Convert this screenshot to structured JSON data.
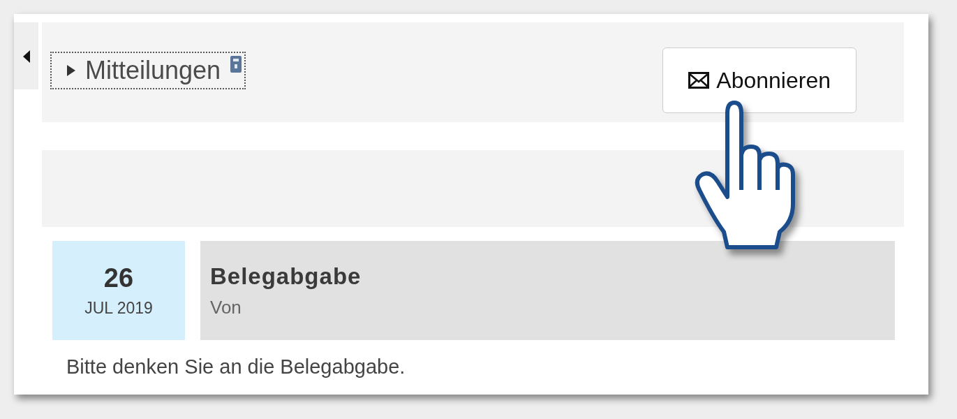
{
  "header": {
    "title": "Mitteilungen",
    "expanded": false,
    "locked": true,
    "subscribe_button": "Abonnieren"
  },
  "posts": [
    {
      "day": "26",
      "month_year": "JUL 2019",
      "subject": "Belegabgabe",
      "byline": "Von",
      "body": "Bitte denken Sie an die Belegabgabe."
    }
  ]
}
